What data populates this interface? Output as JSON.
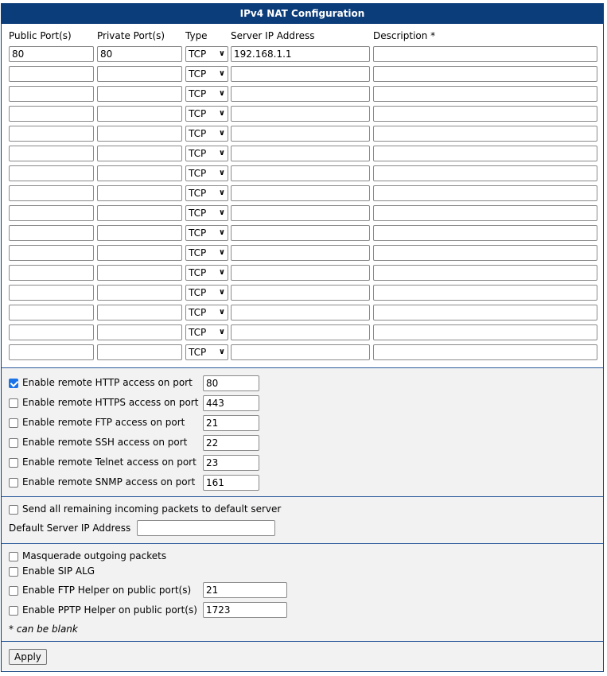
{
  "title": "IPv4 NAT Configuration",
  "headers": {
    "public_port": "Public Port(s)",
    "private_port": "Private Port(s)",
    "type": "Type",
    "server_ip": "Server IP Address",
    "description": "Description *"
  },
  "rules": [
    {
      "public": "80",
      "private": "80",
      "type": "TCP",
      "ip": "192.168.1.1",
      "desc": ""
    },
    {
      "public": "",
      "private": "",
      "type": "TCP",
      "ip": "",
      "desc": ""
    },
    {
      "public": "",
      "private": "",
      "type": "TCP",
      "ip": "",
      "desc": ""
    },
    {
      "public": "",
      "private": "",
      "type": "TCP",
      "ip": "",
      "desc": ""
    },
    {
      "public": "",
      "private": "",
      "type": "TCP",
      "ip": "",
      "desc": ""
    },
    {
      "public": "",
      "private": "",
      "type": "TCP",
      "ip": "",
      "desc": ""
    },
    {
      "public": "",
      "private": "",
      "type": "TCP",
      "ip": "",
      "desc": ""
    },
    {
      "public": "",
      "private": "",
      "type": "TCP",
      "ip": "",
      "desc": ""
    },
    {
      "public": "",
      "private": "",
      "type": "TCP",
      "ip": "",
      "desc": ""
    },
    {
      "public": "",
      "private": "",
      "type": "TCP",
      "ip": "",
      "desc": ""
    },
    {
      "public": "",
      "private": "",
      "type": "TCP",
      "ip": "",
      "desc": ""
    },
    {
      "public": "",
      "private": "",
      "type": "TCP",
      "ip": "",
      "desc": ""
    },
    {
      "public": "",
      "private": "",
      "type": "TCP",
      "ip": "",
      "desc": ""
    },
    {
      "public": "",
      "private": "",
      "type": "TCP",
      "ip": "",
      "desc": ""
    },
    {
      "public": "",
      "private": "",
      "type": "TCP",
      "ip": "",
      "desc": ""
    },
    {
      "public": "",
      "private": "",
      "type": "TCP",
      "ip": "",
      "desc": ""
    }
  ],
  "remote_access": [
    {
      "label": "Enable remote HTTP access on port",
      "port": "80",
      "checked": true
    },
    {
      "label": "Enable remote HTTPS access on port",
      "port": "443",
      "checked": false
    },
    {
      "label": "Enable remote FTP access on port",
      "port": "21",
      "checked": false
    },
    {
      "label": "Enable remote SSH access on port",
      "port": "22",
      "checked": false
    },
    {
      "label": "Enable remote Telnet access on port",
      "port": "23",
      "checked": false
    },
    {
      "label": "Enable remote SNMP access on port",
      "port": "161",
      "checked": false
    }
  ],
  "default_server": {
    "send_label": "Send all remaining incoming packets to default server",
    "send_checked": false,
    "ip_label": "Default Server IP Address",
    "ip_value": ""
  },
  "misc": {
    "masquerade_label": "Masquerade outgoing packets",
    "masquerade_checked": false,
    "sip_label": "Enable SIP ALG",
    "sip_checked": false,
    "ftp_helper_label": "Enable FTP Helper on public port(s)",
    "ftp_helper_port": "21",
    "ftp_helper_checked": false,
    "pptp_helper_label": "Enable PPTP Helper on public port(s)",
    "pptp_helper_port": "1723",
    "pptp_helper_checked": false,
    "note": "* can be blank"
  },
  "apply_label": "Apply",
  "colors": {
    "header_bg": "#0b3d7a",
    "check_on": "#1a73e8"
  }
}
